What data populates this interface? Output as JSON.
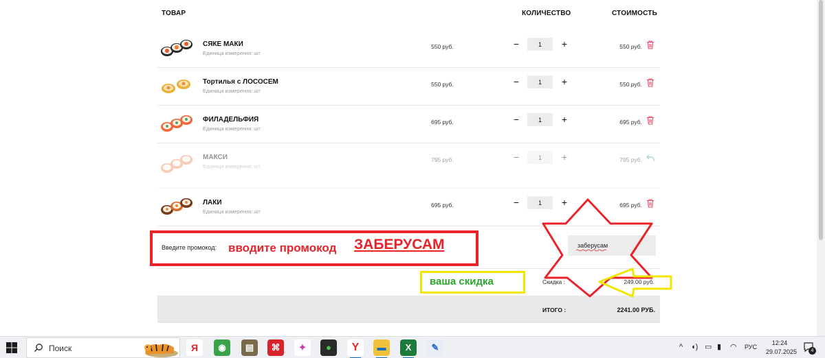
{
  "headers": {
    "product": "ТОВАР",
    "quantity": "КОЛИЧЕСТВО",
    "cost": "СТОИМОСТЬ"
  },
  "items": [
    {
      "name": "СЯКЕ МАКИ",
      "unit": "Единица измерения: шт",
      "price": "550 руб.",
      "qty": "1",
      "cost": "550 руб.",
      "removed": false,
      "action_icon": "trash-icon"
    },
    {
      "name": "Тортилья с ЛОСОСЕМ",
      "unit": "Единица измерения: шт",
      "price": "550 руб.",
      "qty": "1",
      "cost": "550 руб.",
      "removed": false,
      "action_icon": "trash-icon"
    },
    {
      "name": "ФИЛАДЕЛЬФИЯ",
      "unit": "Единица измерения: шт",
      "price": "695 руб.",
      "qty": "1",
      "cost": "695 руб.",
      "removed": false,
      "action_icon": "trash-icon"
    },
    {
      "name": "МАКСИ",
      "unit": "Единица измерения: шт",
      "price": "795 руб.",
      "qty": "1",
      "cost": "795 руб.",
      "removed": true,
      "action_icon": "undo-icon"
    },
    {
      "name": "ЛАКИ",
      "unit": "Единица измерения: шт",
      "price": "695 руб.",
      "qty": "1",
      "cost": "695 руб.",
      "removed": false,
      "action_icon": "trash-icon"
    }
  ],
  "qty_controls": {
    "minus": "−",
    "plus": "+"
  },
  "promo": {
    "label": "Введите промокод:",
    "value": "заберусам"
  },
  "discount": {
    "label": "Скидка :",
    "value": "249.00 руб."
  },
  "total": {
    "label": "ИТОГО :",
    "value": "2241.00 РУБ."
  },
  "annotations": {
    "red_text": "вводите промокод",
    "red_code": "ЗАБЕРУСАМ",
    "yellow_text": "ваша скидка"
  },
  "colors": {
    "annotation_red": "#e8232a",
    "annotation_yellow": "#f2e600",
    "annotation_green": "#2aa82a",
    "trash": "#e8476a",
    "undo": "#3fb56a"
  },
  "taskbar": {
    "search_placeholder": "Поиск",
    "apps": [
      "yandex-browser-icon",
      "maps-icon",
      "archive-icon",
      "pdf-icon",
      "feather-icon",
      "traffic-light-icon",
      "yandex-icon",
      "file-explorer-icon",
      "excel-icon",
      "paint-icon"
    ],
    "language": "РУС",
    "time": "12:24",
    "date": "29.07.2025",
    "notifications": "4"
  }
}
